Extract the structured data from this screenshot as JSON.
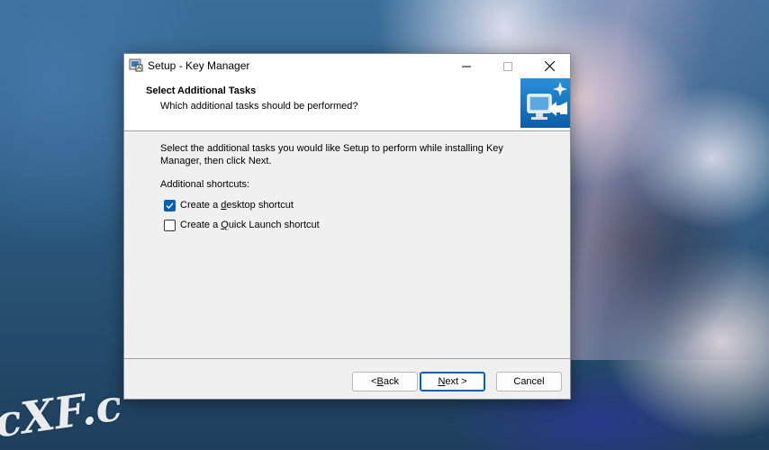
{
  "window": {
    "title": "Setup - Key Manager",
    "controls": {
      "minimize": "minimize",
      "maximize": "maximize",
      "close": "close"
    }
  },
  "header": {
    "title": "Select Additional Tasks",
    "subtitle": "Which additional tasks should be performed?"
  },
  "body": {
    "description": "Select the additional tasks you would like Setup to perform while installing Key Manager, then click Next.",
    "group_label": "Additional shortcuts:",
    "tasks": [
      {
        "pre": "Create a ",
        "accel": "d",
        "post": "esktop shortcut",
        "checked": true
      },
      {
        "pre": "Create a ",
        "accel": "Q",
        "post": "uick Launch shortcut",
        "checked": false
      }
    ]
  },
  "buttons": {
    "back": {
      "pre": "< ",
      "accel": "B",
      "post": "ack"
    },
    "next": {
      "pre": "",
      "accel": "N",
      "post": "ext >"
    },
    "cancel": "Cancel"
  },
  "wallpaper": {
    "watermark": "cXF.c"
  },
  "colors": {
    "accent": "#005fb8",
    "dialog_bg": "#f0f0f0",
    "header_bg": "#ffffff"
  }
}
